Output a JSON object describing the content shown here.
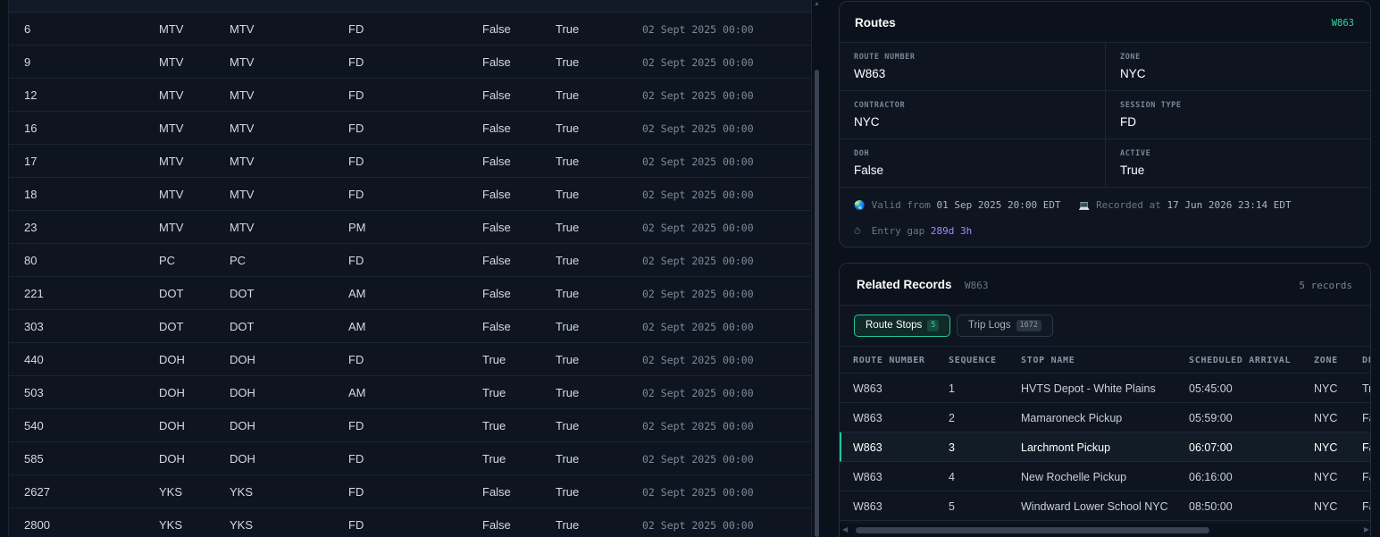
{
  "left_table": {
    "rows": [
      [
        "6",
        "MTV",
        "MTV",
        "FD",
        "False",
        "True",
        "02 Sept 2025 00:00"
      ],
      [
        "9",
        "MTV",
        "MTV",
        "FD",
        "False",
        "True",
        "02 Sept 2025 00:00"
      ],
      [
        "12",
        "MTV",
        "MTV",
        "FD",
        "False",
        "True",
        "02 Sept 2025 00:00"
      ],
      [
        "16",
        "MTV",
        "MTV",
        "FD",
        "False",
        "True",
        "02 Sept 2025 00:00"
      ],
      [
        "17",
        "MTV",
        "MTV",
        "FD",
        "False",
        "True",
        "02 Sept 2025 00:00"
      ],
      [
        "18",
        "MTV",
        "MTV",
        "FD",
        "False",
        "True",
        "02 Sept 2025 00:00"
      ],
      [
        "23",
        "MTV",
        "MTV",
        "PM",
        "False",
        "True",
        "02 Sept 2025 00:00"
      ],
      [
        "80",
        "PC",
        "PC",
        "FD",
        "False",
        "True",
        "02 Sept 2025 00:00"
      ],
      [
        "221",
        "DOT",
        "DOT",
        "AM",
        "False",
        "True",
        "02 Sept 2025 00:00"
      ],
      [
        "303",
        "DOT",
        "DOT",
        "AM",
        "False",
        "True",
        "02 Sept 2025 00:00"
      ],
      [
        "440",
        "DOH",
        "DOH",
        "FD",
        "True",
        "True",
        "02 Sept 2025 00:00"
      ],
      [
        "503",
        "DOH",
        "DOH",
        "AM",
        "True",
        "True",
        "02 Sept 2025 00:00"
      ],
      [
        "540",
        "DOH",
        "DOH",
        "FD",
        "True",
        "True",
        "02 Sept 2025 00:00"
      ],
      [
        "585",
        "DOH",
        "DOH",
        "FD",
        "True",
        "True",
        "02 Sept 2025 00:00"
      ],
      [
        "2627",
        "YKS",
        "YKS",
        "FD",
        "False",
        "True",
        "02 Sept 2025 00:00"
      ],
      [
        "2800",
        "YKS",
        "YKS",
        "FD",
        "False",
        "True",
        "02 Sept 2025 00:00"
      ]
    ]
  },
  "routes": {
    "title": "Routes",
    "badge": "W863",
    "fields": {
      "route_number": {
        "label": "ROUTE NUMBER",
        "value": "W863"
      },
      "zone": {
        "label": "ZONE",
        "value": "NYC"
      },
      "contractor": {
        "label": "CONTRACTOR",
        "value": "NYC"
      },
      "session_type": {
        "label": "SESSION TYPE",
        "value": "FD"
      },
      "doh": {
        "label": "DOH",
        "value": "False"
      },
      "active": {
        "label": "ACTIVE",
        "value": "True"
      }
    },
    "meta": {
      "valid_label": "Valid from",
      "valid_value": "01 Sep 2025 20:00 EDT",
      "recorded_label": "Recorded at",
      "recorded_value": "17 Jun 2026 23:14 EDT",
      "gap_label": "Entry gap",
      "gap_value": "289d 3h"
    }
  },
  "related": {
    "title": "Related Records",
    "subtitle": "W863",
    "count": "5 records",
    "tabs": [
      {
        "label": "Route Stops",
        "count": "5"
      },
      {
        "label": "Trip Logs",
        "count": "1672"
      }
    ],
    "columns": [
      "ROUTE NUMBER",
      "SEQUENCE",
      "STOP NAME",
      "SCHEDULED ARRIVAL",
      "ZONE",
      "DE"
    ],
    "rows": [
      [
        "W863",
        "1",
        "HVTS Depot - White Plains",
        "05:45:00",
        "NYC",
        "Tr"
      ],
      [
        "W863",
        "2",
        "Mamaroneck Pickup",
        "05:59:00",
        "NYC",
        "Fa"
      ],
      [
        "W863",
        "3",
        "Larchmont Pickup",
        "06:07:00",
        "NYC",
        "Fa"
      ],
      [
        "W863",
        "4",
        "New Rochelle Pickup",
        "06:16:00",
        "NYC",
        "Fa"
      ],
      [
        "W863",
        "5",
        "Windward Lower School NYC",
        "08:50:00",
        "NYC",
        "Fa"
      ]
    ],
    "selected_row": 2
  },
  "colors": {
    "accent": "#2fd6a6",
    "gap": "#a887ff",
    "background": "#0b111a"
  }
}
